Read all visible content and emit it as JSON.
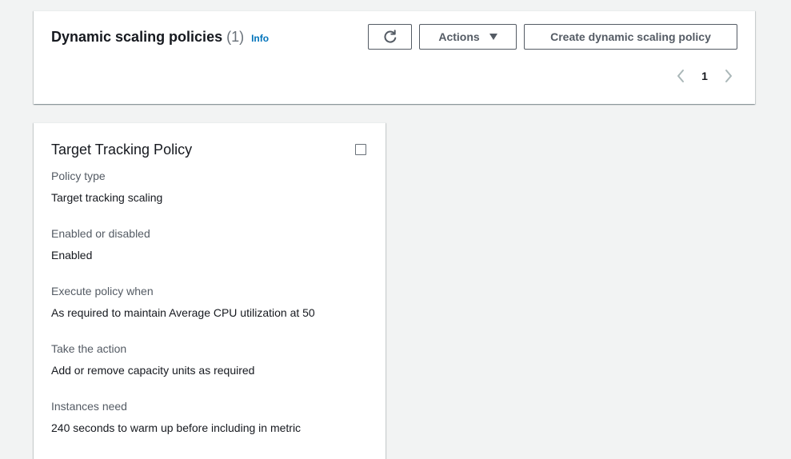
{
  "header": {
    "title": "Dynamic scaling policies",
    "count": "(1)",
    "info_label": "Info",
    "actions_label": "Actions",
    "create_label": "Create dynamic scaling policy",
    "refresh_icon": "refresh-icon",
    "caret_icon": "caret-down-icon"
  },
  "pagination": {
    "current_page": "1",
    "prev_icon": "chevron-left-icon",
    "next_icon": "chevron-right-icon"
  },
  "policy": {
    "name": "Target Tracking Policy",
    "fields": [
      {
        "label": "Policy type",
        "value": "Target tracking scaling"
      },
      {
        "label": "Enabled or disabled",
        "value": "Enabled"
      },
      {
        "label": "Execute policy when",
        "value": "As required to maintain Average CPU utilization at 50"
      },
      {
        "label": "Take the action",
        "value": "Add or remove capacity units as required"
      },
      {
        "label": "Instances need",
        "value": "240 seconds to warm up before including in metric"
      }
    ]
  },
  "colors": {
    "background": "#f2f3f3",
    "link": "#0073bb",
    "text": "#16191f",
    "label": "#545b64",
    "muted": "#687078",
    "border": "#545b64"
  }
}
